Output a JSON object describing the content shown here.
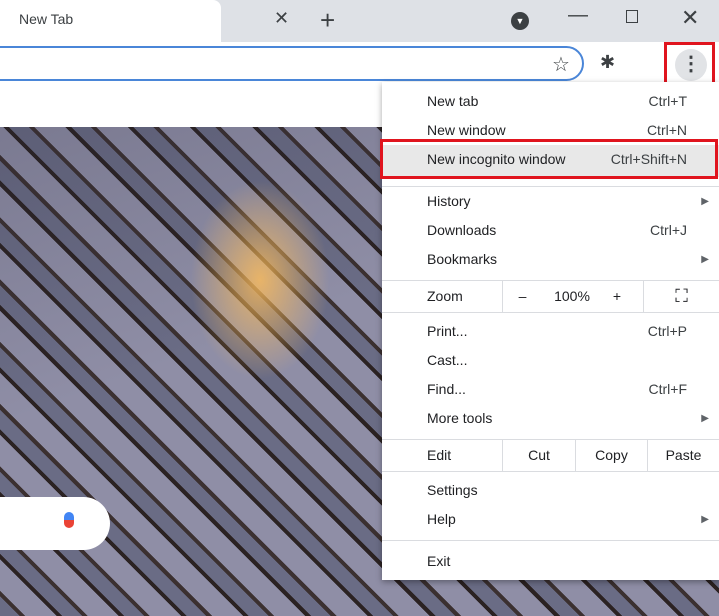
{
  "tab": {
    "title": "New Tab",
    "close": "✕",
    "new_tab": "+"
  },
  "window": {
    "minimize": "—",
    "close": "✕"
  },
  "toolbar": {
    "star": "☆",
    "extensions": "✱",
    "menu": "⋮"
  },
  "menu": {
    "new_tab": {
      "label": "New tab",
      "shortcut": "Ctrl+T"
    },
    "new_window": {
      "label": "New window",
      "shortcut": "Ctrl+N"
    },
    "incognito": {
      "label": "New incognito window",
      "shortcut": "Ctrl+Shift+N"
    },
    "history": {
      "label": "History"
    },
    "downloads": {
      "label": "Downloads",
      "shortcut": "Ctrl+J"
    },
    "bookmarks": {
      "label": "Bookmarks"
    },
    "zoom": {
      "label": "Zoom",
      "minus": "–",
      "value": "100%",
      "plus": "+",
      "fullscreen": "⛶"
    },
    "print": {
      "label": "Print...",
      "shortcut": "Ctrl+P"
    },
    "cast": {
      "label": "Cast..."
    },
    "find": {
      "label": "Find...",
      "shortcut": "Ctrl+F"
    },
    "more_tools": {
      "label": "More tools"
    },
    "edit": {
      "label": "Edit",
      "cut": "Cut",
      "copy": "Copy",
      "paste": "Paste"
    },
    "settings": {
      "label": "Settings"
    },
    "help": {
      "label": "Help"
    },
    "exit": {
      "label": "Exit"
    },
    "arrow": "▶"
  }
}
